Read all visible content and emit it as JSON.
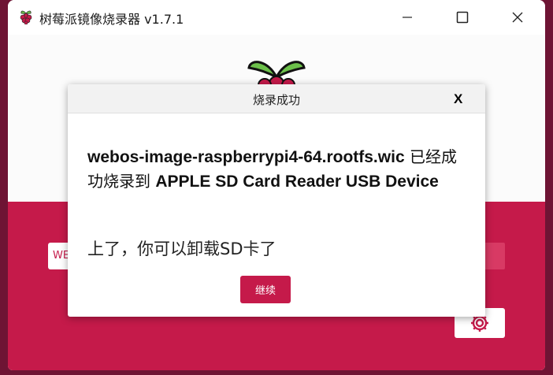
{
  "window": {
    "title": "树莓派镜像烧录器 v1.7.1"
  },
  "icons": {
    "app": "raspberry-icon",
    "minimize": "minimize-icon",
    "maximize": "maximize-icon",
    "close": "close-icon",
    "settings": "gear-icon"
  },
  "main": {
    "os_button_label": "WE"
  },
  "dialog": {
    "title": "烧录成功",
    "close_label": "X",
    "image_name": "webos-image-raspberrypi4-64.rootfs.wic",
    "message_mid": " 已经成功烧录到 ",
    "device_name": "APPLE SD Card Reader USB Device",
    "hint": "上了，你可以卸载SD卡了",
    "continue_label": "继续"
  },
  "colors": {
    "accent": "#c51a4a",
    "leaf": "#6cc04a",
    "berry": "#c51a4a",
    "desktop": "#6e1434"
  }
}
